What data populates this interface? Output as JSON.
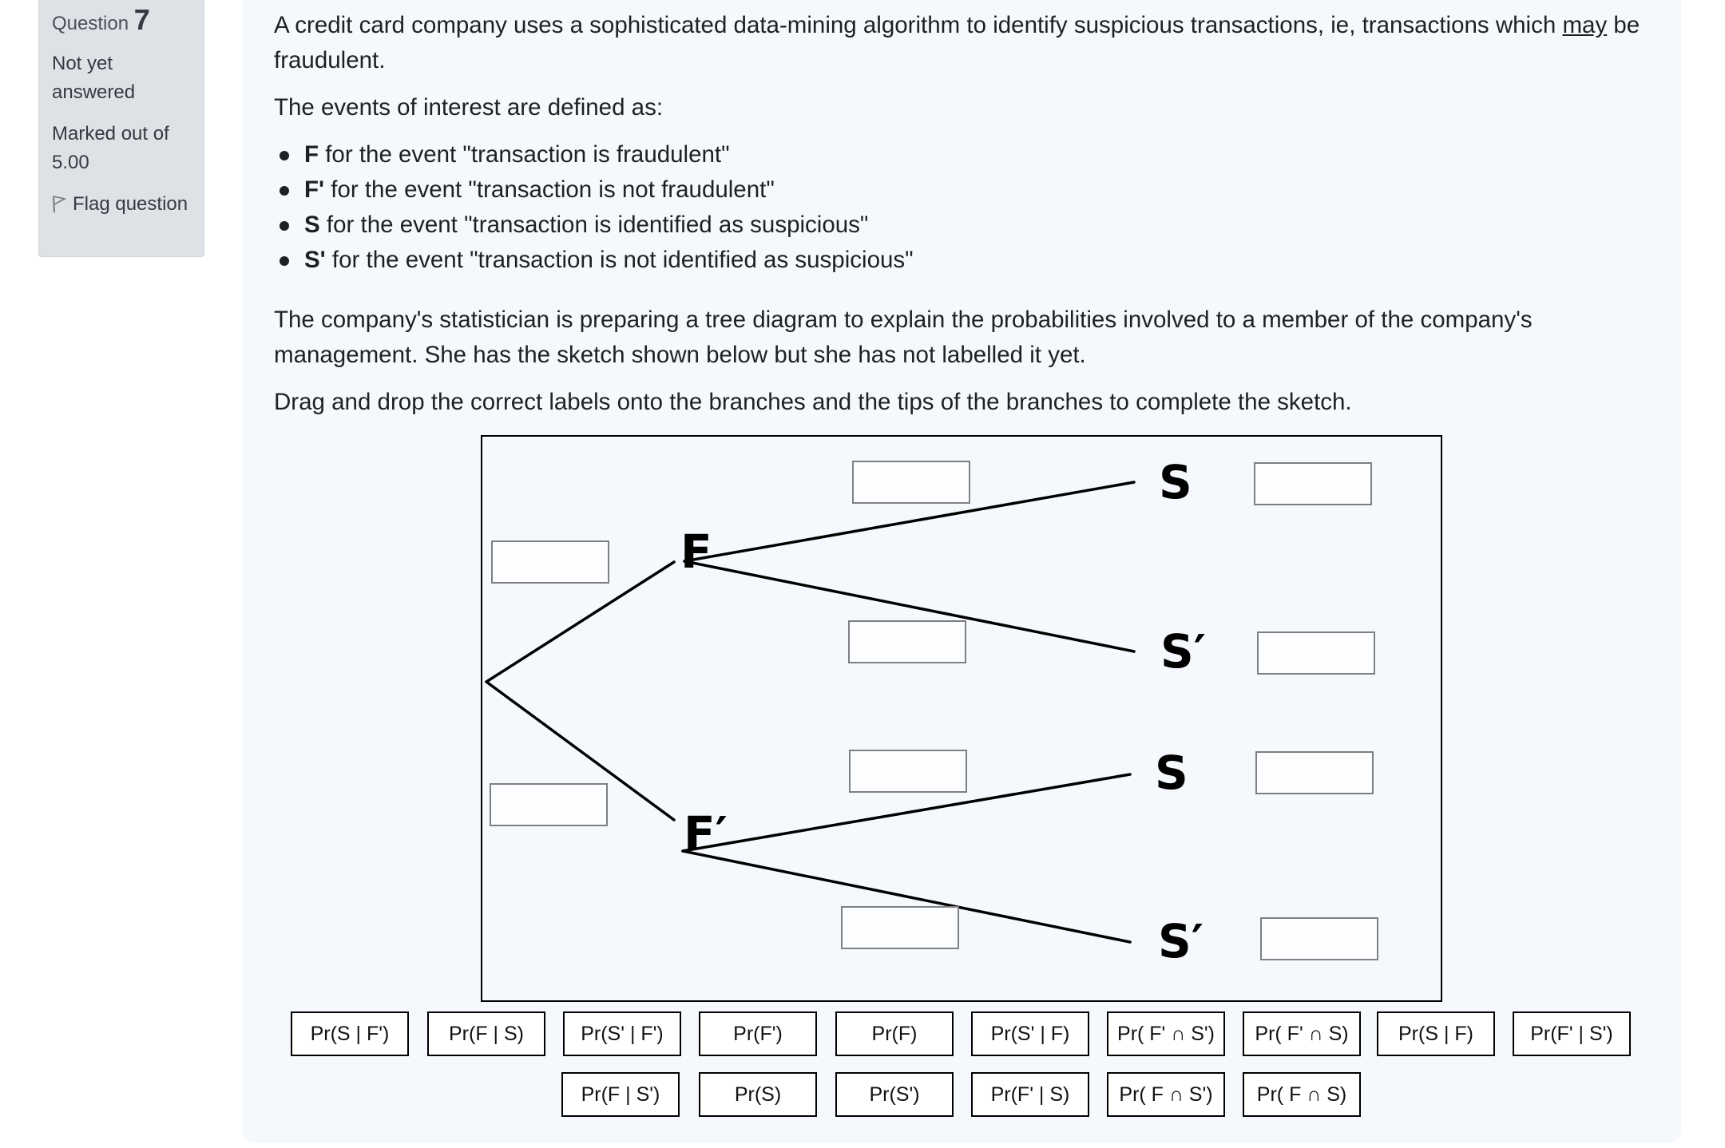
{
  "question_info": {
    "label": "Question",
    "number": "7",
    "state": "Not yet answered",
    "grade": "Marked out of 5.00",
    "flag_label": "Flag question",
    "flag_icon": "flag-icon"
  },
  "question": {
    "intro_before_may": "A credit card company uses a sophisticated data-mining algorithm to identify suspicious transactions, ie, transactions which ",
    "intro_may": "may",
    "intro_after_may": " be fraudulent.",
    "events_heading": "The events of interest are defined as:",
    "events": [
      {
        "symbol": "F",
        "text": " for the event \"transaction is fraudulent\""
      },
      {
        "symbol": "F'",
        "text": " for the event \"transaction is not fraudulent\""
      },
      {
        "symbol": "S",
        "text": " for the event \"transaction is identified as suspicious\""
      },
      {
        "symbol": "S'",
        "text": " for the event \"transaction is not identified as suspicious\""
      }
    ],
    "context": "The company's statistician is preparing a tree diagram to explain the probabilities involved to a member of the company's management. She has the sketch shown below but she has not labelled it yet.",
    "instruction": "Drag and drop the correct labels onto the branches and the tips of the branches to complete the sketch."
  },
  "diagram": {
    "nodes": {
      "f": "F",
      "f_prime": "F′",
      "s_upper": "S",
      "s_prime_upper": "S′",
      "s_lower": "S",
      "s_prime_lower": "S′"
    },
    "drop_zones": [
      {
        "id": "branch-f",
        "value": ""
      },
      {
        "id": "branch-f-prime",
        "value": ""
      },
      {
        "id": "branch-f-s",
        "value": ""
      },
      {
        "id": "branch-f-s-prime",
        "value": ""
      },
      {
        "id": "branch-f-prime-s",
        "value": ""
      },
      {
        "id": "branch-f-prime-s-prime",
        "value": ""
      },
      {
        "id": "tip-f-s",
        "value": ""
      },
      {
        "id": "tip-f-s-prime",
        "value": ""
      },
      {
        "id": "tip-f-prime-s",
        "value": ""
      },
      {
        "id": "tip-f-prime-s-prime",
        "value": ""
      }
    ]
  },
  "drag_items": {
    "row1": [
      "Pr(S | F')",
      "Pr(F | S)",
      "Pr(S' | F')",
      "Pr(F')",
      "Pr(F)",
      "Pr(S' | F)",
      "Pr( F' ∩ S')",
      "Pr( F' ∩ S)",
      "Pr(S | F)",
      "Pr(F' | S')"
    ],
    "row2": [
      "Pr(F | S')",
      "Pr(S)",
      "Pr(S')",
      "Pr(F' | S)",
      "Pr( F ∩ S')",
      "Pr( F ∩ S)"
    ]
  }
}
